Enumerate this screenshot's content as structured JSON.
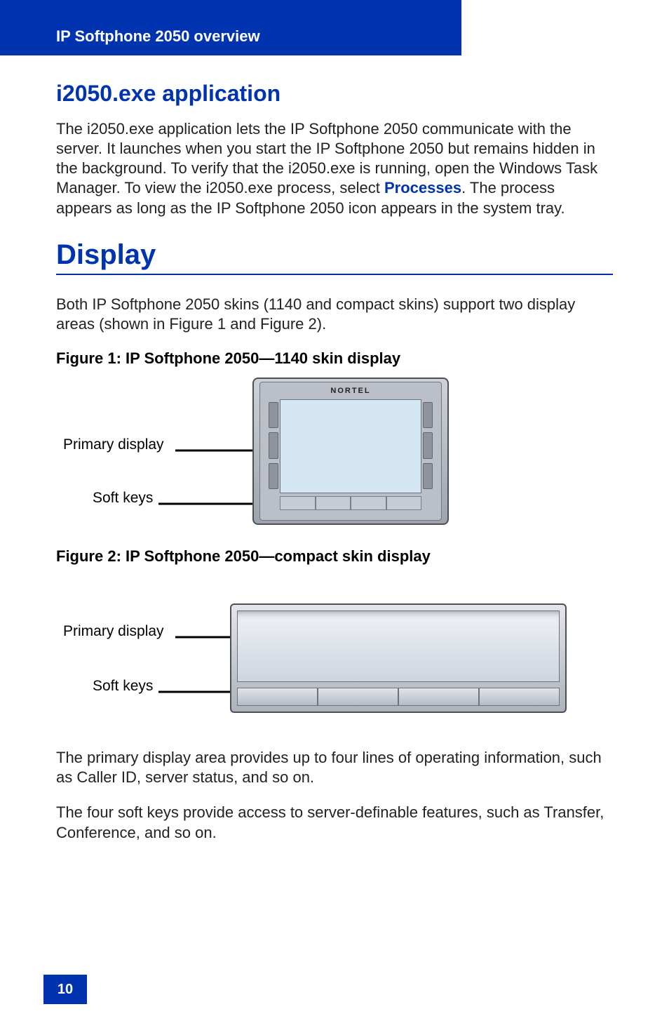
{
  "header": {
    "running_head": "IP Softphone 2050 overview"
  },
  "section_app": {
    "title": "i2050.exe application",
    "para_before_bold": "The i2050.exe application lets the IP Softphone 2050 communicate with the server. It launches when you start the IP Softphone 2050 but remains hidden in the background. To verify that the i2050.exe is running, open the Windows Task Manager. To view the i2050.exe process, select ",
    "bold_term": "Processes",
    "para_after_bold": ". The process appears as long as the IP Softphone 2050 icon appears in the system tray."
  },
  "section_display": {
    "title": "Display",
    "intro": "Both IP Softphone 2050 skins (1140 and compact skins) support two display areas (shown in Figure 1 and Figure 2).",
    "fig1_caption": "Figure 1: IP Softphone 2050—1140 skin display",
    "fig2_caption": "Figure 2: IP Softphone 2050—compact skin display",
    "labels": {
      "primary_display": "Primary display",
      "soft_keys": "Soft keys"
    },
    "brand": "NORTEL",
    "para_primary": "The primary display area provides up to four lines of operating information, such as Caller ID, server status, and so on.",
    "para_softkeys": "The four soft keys provide access to server-definable features, such as Transfer, Conference, and so on."
  },
  "page": {
    "number": "10"
  }
}
